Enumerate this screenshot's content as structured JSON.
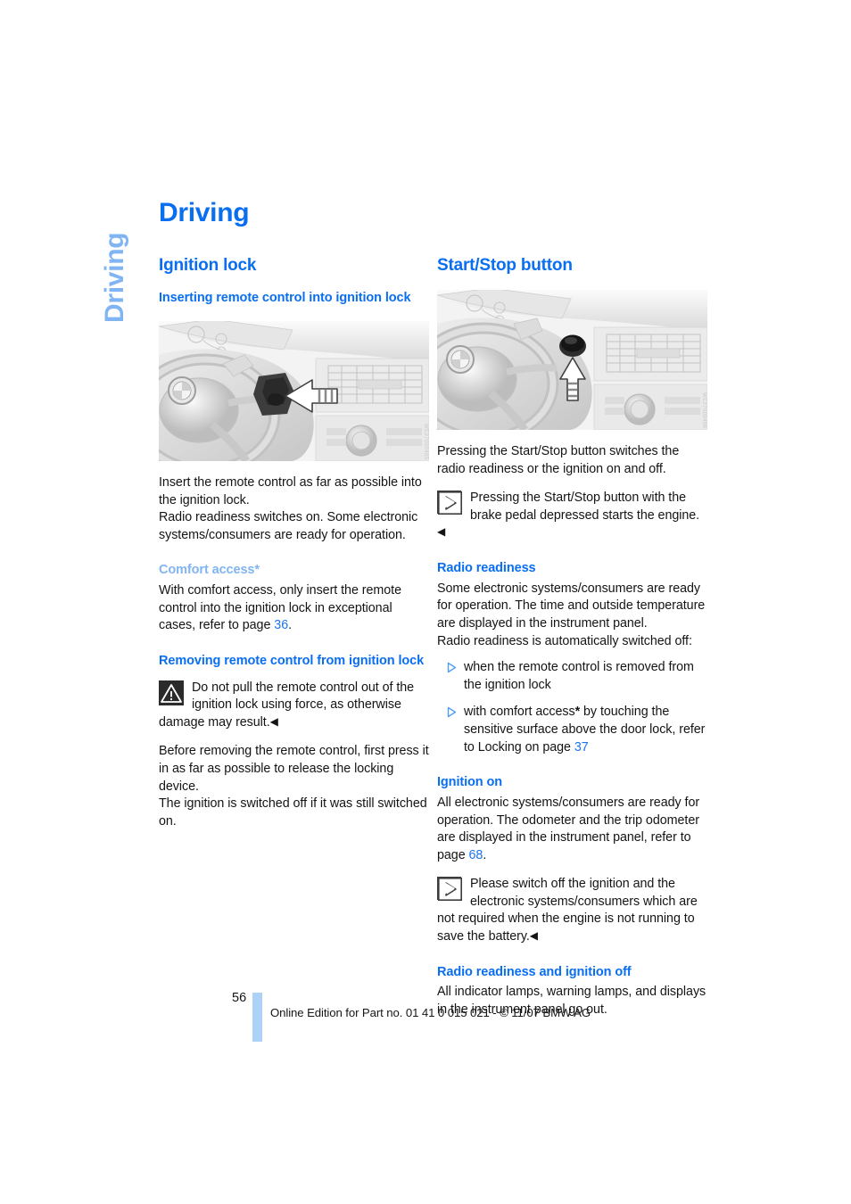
{
  "chapter": {
    "tab_label": "Driving",
    "title": "Driving"
  },
  "colors": {
    "heading_blue": "#0a6ef0",
    "light_blue": "#80b4f2",
    "link_blue": "#1a74f0",
    "footer_bar": "#aed2f7"
  },
  "left_column": {
    "section_heading": "Ignition lock",
    "sub1_heading": "Inserting remote control into ignition lock",
    "figure1_code": "WE27000495",
    "para1": "Insert the remote control as far as possible into the ignition lock.",
    "para2": "Radio readiness switches on. Some electronic systems/consumers are ready for operation.",
    "sub2_heading": "Comfort access*",
    "para3_pre": "With comfort access, only insert the remote control into the ignition lock in exceptional cases, refer to page ",
    "para3_link": "36",
    "para3_post": ".",
    "sub3_heading": "Removing remote control from ignition lock",
    "warning_text": "Do not pull the remote control out of the ignition lock using force, as otherwise damage may result.",
    "warning_end_mark": "◀",
    "para4": "Before removing the remote control, first press it in as far as possible to release the locking device.",
    "para5": "The ignition is switched off if it was still switched on."
  },
  "right_column": {
    "section_heading": "Start/Stop button",
    "figure2_code": "WE27000496",
    "para1": "Pressing the Start/Stop button switches the radio readiness or the ignition on and off.",
    "note1_text": "Pressing the Start/Stop button with the brake pedal depressed starts the engine.",
    "note1_end_mark": "◀",
    "sub1_heading": "Radio readiness",
    "para2": "Some electronic systems/consumers are ready for operation. The time and outside temperature are displayed in the instrument panel.",
    "para3": "Radio readiness is automatically switched off:",
    "bullets": [
      {
        "text_pre": "when the remote control is removed from the ignition lock",
        "star": "",
        "text_mid": "",
        "link": "",
        "text_post": ""
      },
      {
        "text_pre": "with comfort access",
        "star": "*",
        "text_mid": " by touching the sensitive surface above the door lock, refer to Locking on page ",
        "link": "37",
        "text_post": ""
      }
    ],
    "sub2_heading": "Ignition on",
    "para4_pre": "All electronic systems/consumers are ready for operation. The odometer and the trip odometer are displayed in the instrument panel, refer to page ",
    "para4_link": "68",
    "para4_post": ".",
    "note2_text": "Please switch off the ignition and the electronic systems/consumers which are not required when the engine is not running to save the battery.",
    "note2_end_mark": "◀",
    "sub3_heading": "Radio readiness and ignition off",
    "para5": "All indicator lamps, warning lamps, and displays in the instrument panel go out."
  },
  "footer": {
    "page_number": "56",
    "imprint": "Online Edition for Part no. 01 41 0 015 021 - © 11/07 BMW AG"
  }
}
